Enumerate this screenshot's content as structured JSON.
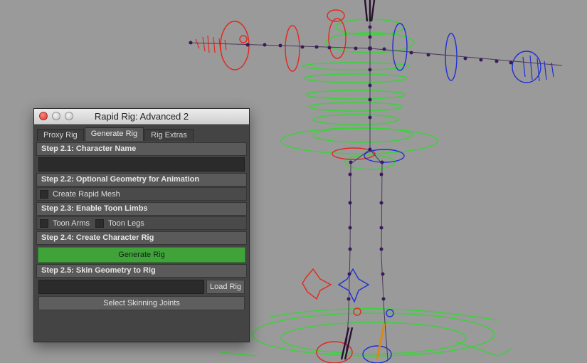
{
  "window": {
    "title": "Rapid Rig: Advanced 2"
  },
  "tabs": [
    {
      "label": "Proxy Rig"
    },
    {
      "label": "Generate Rig"
    },
    {
      "label": "Rig Extras"
    }
  ],
  "steps": {
    "s1": "Step 2.1: Character Name",
    "s2": "Step 2.2: Optional Geometry for Animation",
    "s3": "Step 2.3: Enable Toon Limbs",
    "s4": "Step 2.4: Create Character Rig",
    "s5": "Step 2.5: Skin Geometry to Rig"
  },
  "character_name_value": "",
  "create_rapid_mesh_label": "Create Rapid Mesh",
  "toon_arms_label": "Toon Arms",
  "toon_legs_label": "Toon Legs",
  "generate_rig_label": "Generate Rig",
  "load_rig_value": "",
  "load_rig_label": "Load Rig",
  "select_skinning_joints_label": "Select Skinning Joints",
  "colors": {
    "viewport_bg": "#9a9a9a",
    "left_side": "#e0291e",
    "right_side": "#1f2fd6",
    "center": "#38d438",
    "joint": "#3a1a5a",
    "generate_button": "#3fa33a"
  }
}
